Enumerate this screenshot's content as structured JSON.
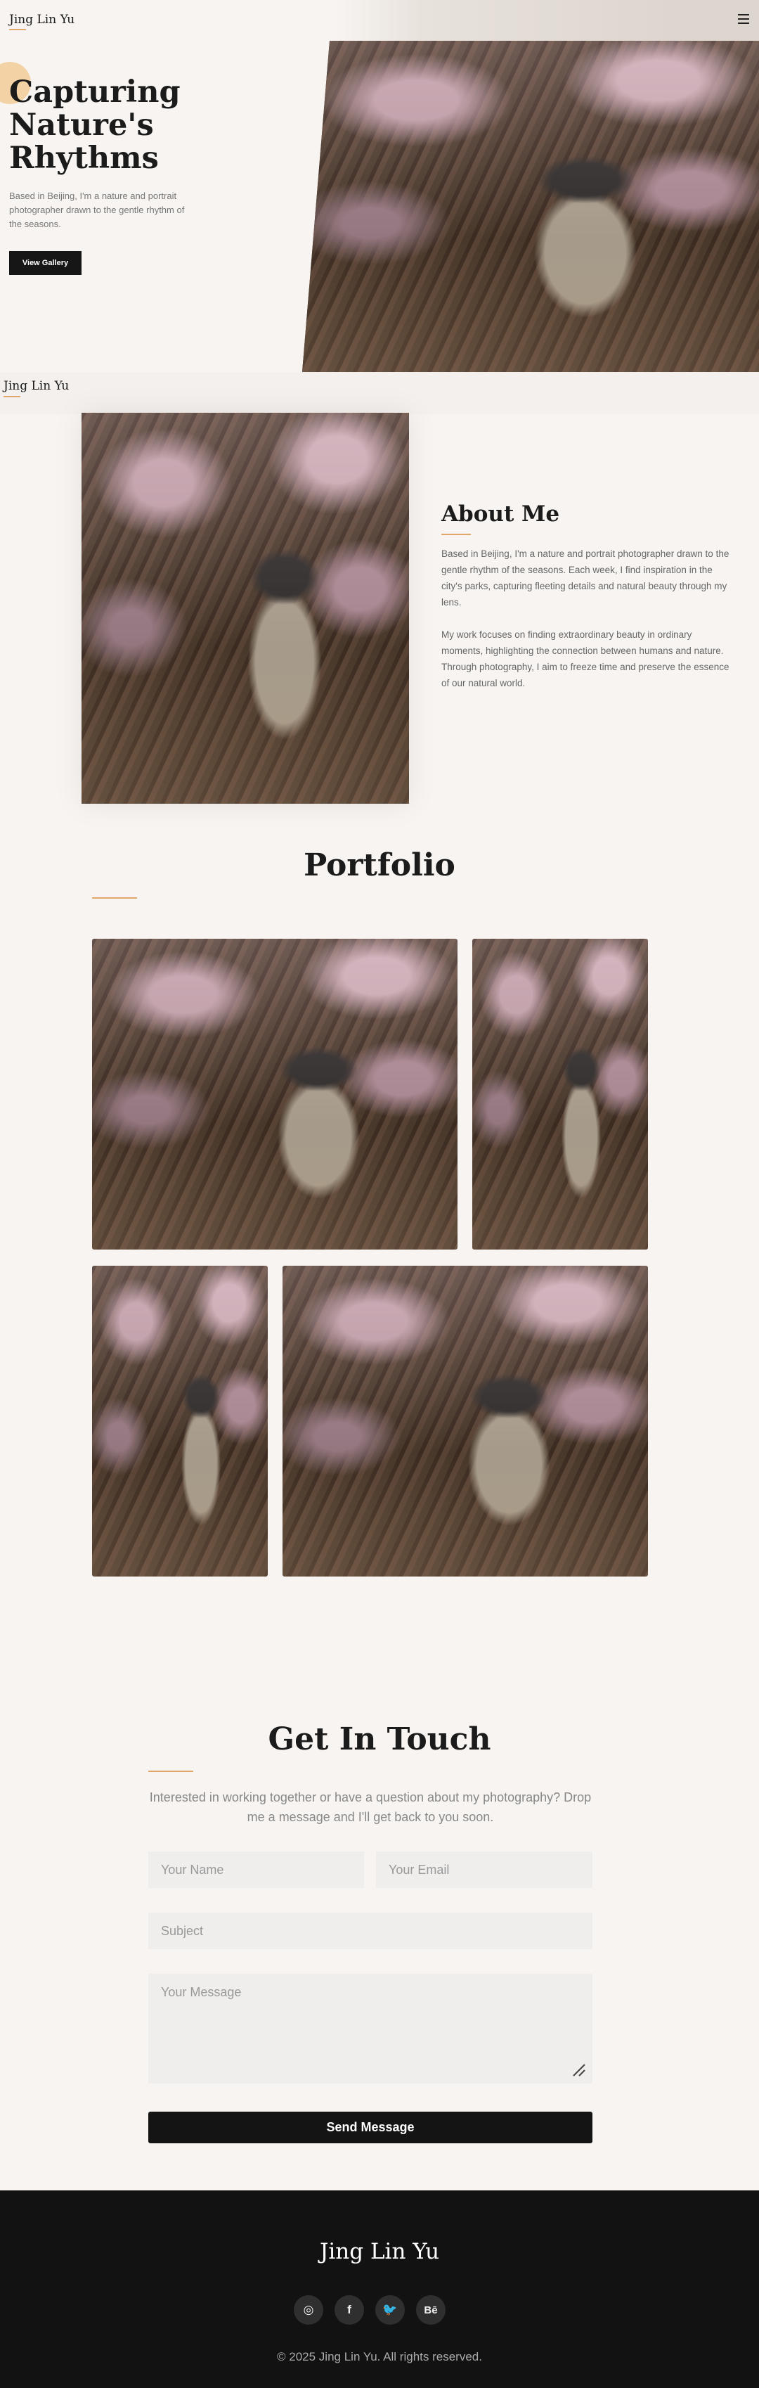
{
  "header": {
    "logo": "Jing Lin Yu",
    "menu_icon": "hamburger-menu-icon"
  },
  "hero": {
    "title": "Capturing Nature's Rhythms",
    "text": "Based in Beijing, I'm a nature and portrait photographer drawn to the gentle rhythm of the seasons.",
    "button": "View Gallery"
  },
  "secondary_logo": "Jing Lin Yu",
  "about": {
    "title": "About Me",
    "p1": "Based in Beijing, I'm a nature and portrait photographer drawn to the gentle rhythm of the seasons. Each week, I find inspiration in the city's parks, capturing fleeting details and natural beauty through my lens.",
    "p2": "My work focuses on finding extraordinary beauty in ordinary moments, highlighting the connection between humans and nature. Through photography, I aim to freeze time and preserve the essence of our natural world."
  },
  "portfolio": {
    "title": "Portfolio"
  },
  "contact": {
    "title": "Get In Touch",
    "text": "Interested in working together or have a question about my photography? Drop me a message and I'll get back to you soon.",
    "name_placeholder": "Your Name",
    "email_placeholder": "Your Email",
    "subject_placeholder": "Subject",
    "message_placeholder": "Your Message",
    "send_label": "Send Message"
  },
  "footer": {
    "logo": "Jing Lin Yu",
    "social": [
      {
        "icon": "instagram-icon",
        "glyph": "◎"
      },
      {
        "icon": "facebook-icon",
        "glyph": "f"
      },
      {
        "icon": "twitter-icon",
        "glyph": "🐦"
      },
      {
        "icon": "behance-icon",
        "glyph": "Bē"
      }
    ],
    "copyright": "© 2025 Jing Lin Yu. All rights reserved."
  },
  "colors": {
    "accent": "#e0a868",
    "background": "#f7f4f1",
    "dark": "#121212"
  }
}
